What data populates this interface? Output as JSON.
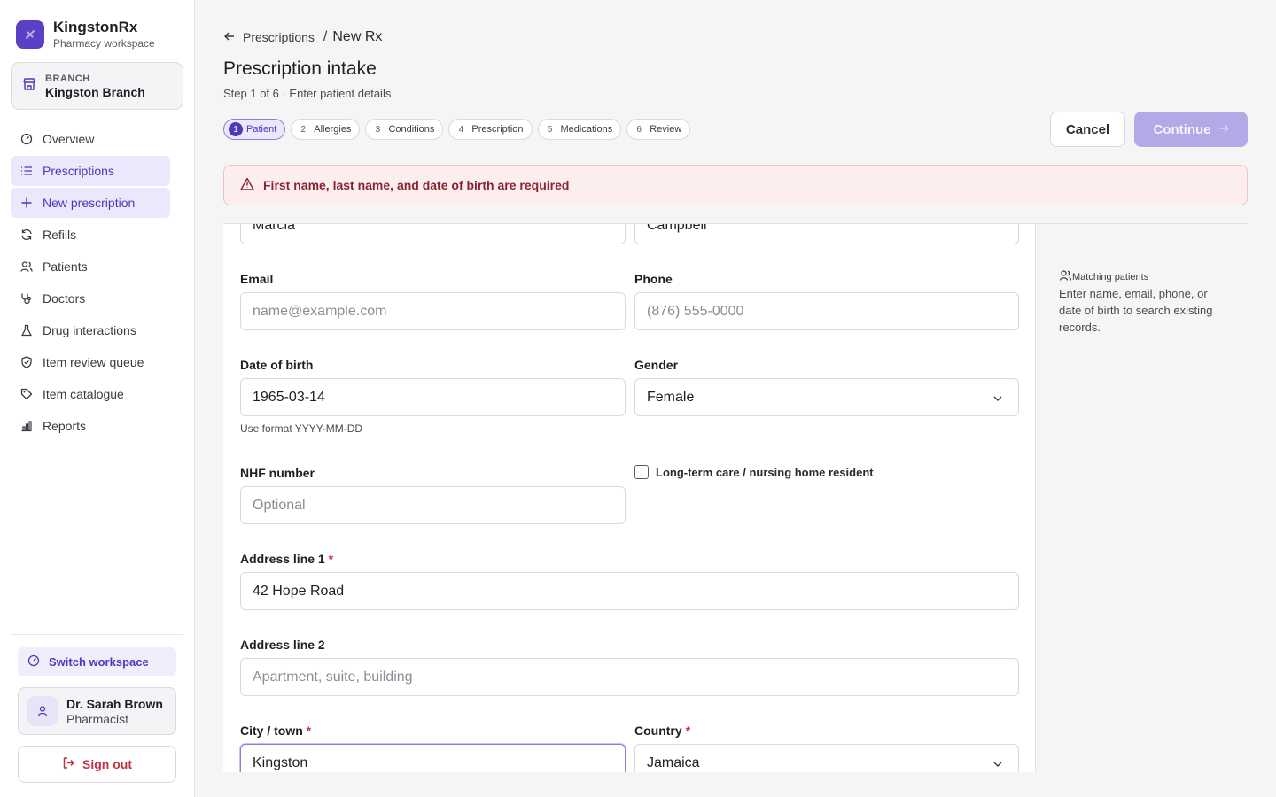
{
  "brand": {
    "name": "KingstonRx",
    "subtitle": "Pharmacy workspace",
    "accent": "#5b3fc4"
  },
  "branch": {
    "label": "BRANCH",
    "name": "Kingston Branch"
  },
  "nav": [
    {
      "label": "Overview",
      "icon": "gauge-icon"
    },
    {
      "label": "Prescriptions",
      "icon": "list-icon",
      "active": true
    },
    {
      "label": "New prescription",
      "icon": "plus-icon",
      "active": true
    },
    {
      "label": "Refills",
      "icon": "refresh-icon"
    },
    {
      "label": "Patients",
      "icon": "users-icon"
    },
    {
      "label": "Doctors",
      "icon": "stethoscope-icon"
    },
    {
      "label": "Drug interactions",
      "icon": "flask-icon"
    },
    {
      "label": "Item review queue",
      "icon": "shield-check-icon"
    },
    {
      "label": "Item catalogue",
      "icon": "tag-icon"
    },
    {
      "label": "Reports",
      "icon": "bar-chart-icon"
    }
  ],
  "switch_workspace": "Switch workspace",
  "user": {
    "name": "Dr. Sarah Brown",
    "role": "Pharmacist"
  },
  "sign_out": "Sign out",
  "breadcrumb": {
    "parent": "Prescriptions",
    "separator": "/",
    "current": "New Rx"
  },
  "page": {
    "title": "Prescription intake",
    "subtitle": "Step 1 of 6 · Enter patient details"
  },
  "steps": [
    {
      "num": "1",
      "label": "Patient",
      "active": true
    },
    {
      "num": "2",
      "label": "Allergies"
    },
    {
      "num": "3",
      "label": "Conditions"
    },
    {
      "num": "4",
      "label": "Prescription"
    },
    {
      "num": "5",
      "label": "Medications"
    },
    {
      "num": "6",
      "label": "Review"
    }
  ],
  "actions": {
    "cancel": "Cancel",
    "continue": "Continue"
  },
  "alert": {
    "message": "First name, last name, and date of birth are required",
    "color": "#8a2430"
  },
  "form": {
    "first_name_value": "Marcia",
    "last_name_value": "Campbell",
    "email": {
      "label": "Email",
      "placeholder": "name@example.com"
    },
    "phone": {
      "label": "Phone",
      "placeholder": "(876) 555-0000"
    },
    "dob": {
      "label": "Date of birth",
      "value": "1965-03-14",
      "hint": "Use format YYYY-MM-DD"
    },
    "gender": {
      "label": "Gender",
      "value": "Female"
    },
    "nhf": {
      "label": "NHF number",
      "placeholder": "Optional"
    },
    "ltc": {
      "label": "Long-term care / nursing home resident",
      "checked": false
    },
    "address1": {
      "label": "Address line 1",
      "required": "*",
      "value": "42 Hope Road"
    },
    "address2": {
      "label": "Address line 2",
      "placeholder": "Apartment, suite, building"
    },
    "city": {
      "label": "City / town",
      "required": "*",
      "value": "Kingston"
    },
    "country": {
      "label": "Country",
      "required": "*",
      "value": "Jamaica"
    }
  },
  "matching": {
    "title": "Matching patients",
    "description": "Enter name, email, phone, or date of birth to search existing records."
  }
}
